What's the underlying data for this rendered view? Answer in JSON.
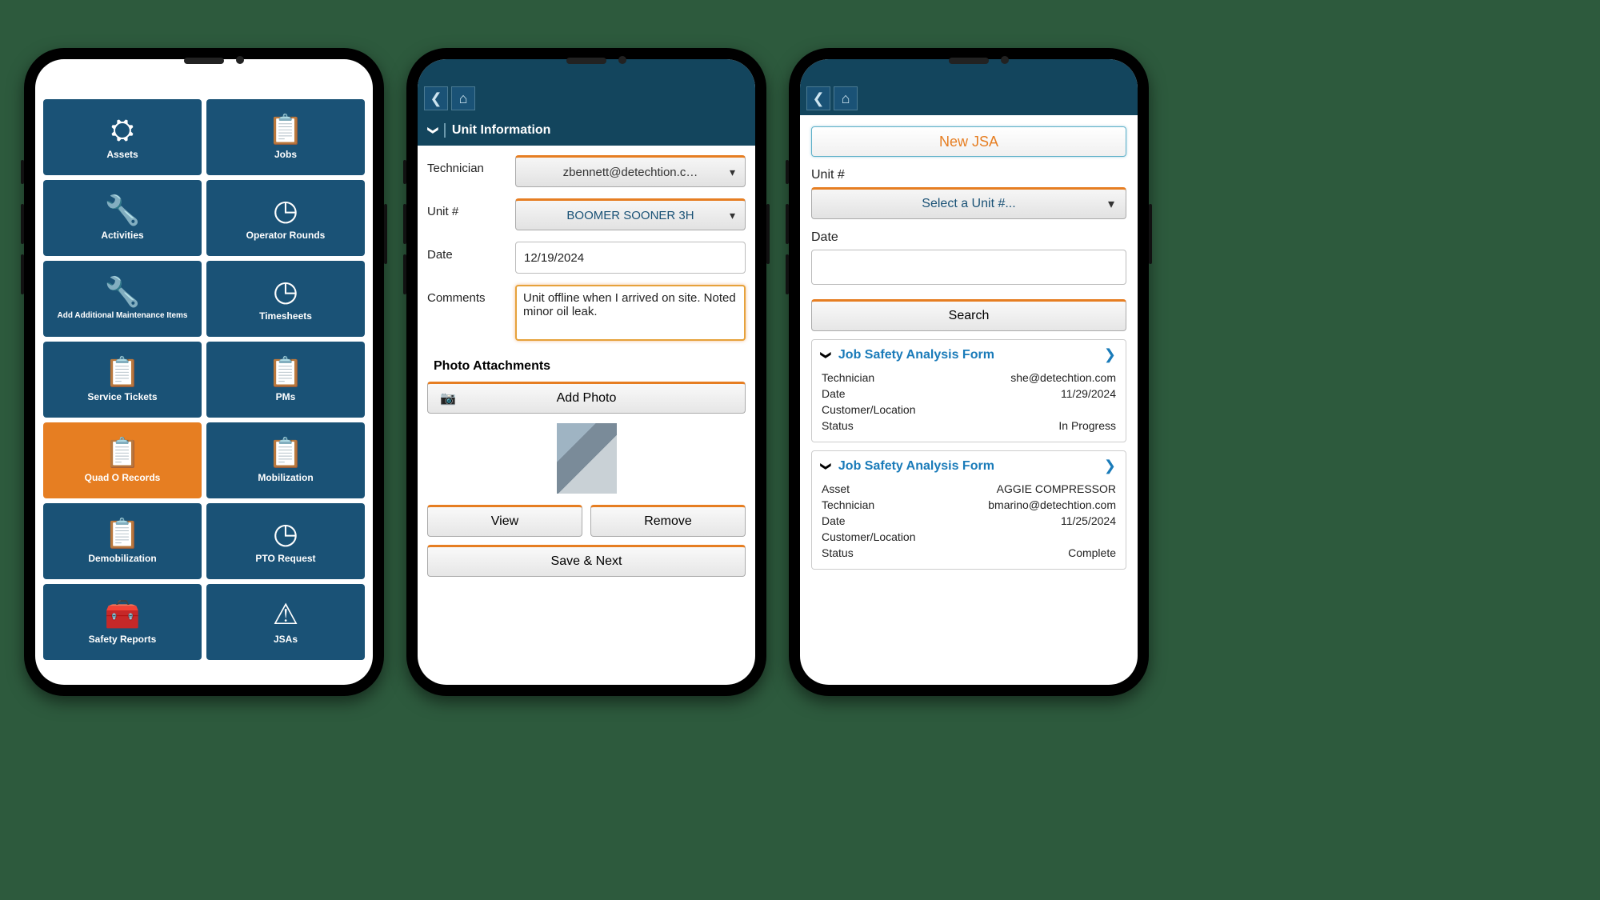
{
  "colors": {
    "primary": "#1a5276",
    "accent": "#e67e22",
    "link": "#1a7bb9"
  },
  "phone1": {
    "tiles": [
      {
        "label": "Assets",
        "icon": "⛭"
      },
      {
        "label": "Jobs",
        "icon": "📋"
      },
      {
        "label": "Activities",
        "icon": "🔧"
      },
      {
        "label": "Operator Rounds",
        "icon": "◷"
      },
      {
        "label": "Add Additional Maintenance Items",
        "icon": "🔧"
      },
      {
        "label": "Timesheets",
        "icon": "◷"
      },
      {
        "label": "Service Tickets",
        "icon": "📋"
      },
      {
        "label": "PMs",
        "icon": "📋"
      },
      {
        "label": "Quad O Records",
        "icon": "📋",
        "active": true
      },
      {
        "label": "Mobilization",
        "icon": "📋"
      },
      {
        "label": "Demobilization",
        "icon": "📋"
      },
      {
        "label": "PTO Request",
        "icon": "◷"
      },
      {
        "label": "Safety Reports",
        "icon": "🧰"
      },
      {
        "label": "JSAs",
        "icon": "⚠"
      }
    ]
  },
  "phone2": {
    "section": "Unit Information",
    "fields": {
      "technician_label": "Technician",
      "technician_value": "zbennett@detechtion.c…",
      "unit_label": "Unit #",
      "unit_value": "BOOMER SOONER 3H",
      "date_label": "Date",
      "date_value": "12/19/2024",
      "comments_label": "Comments",
      "comments_value": "Unit offline when I arrived on site. Noted minor oil leak."
    },
    "photo_header": "Photo Attachments",
    "buttons": {
      "add_photo": "Add Photo",
      "view": "View",
      "remove": "Remove",
      "save_next": "Save & Next"
    }
  },
  "phone3": {
    "new_btn": "New JSA",
    "unit_label": "Unit #",
    "unit_placeholder": "Select a Unit #...",
    "date_label": "Date",
    "search_btn": "Search",
    "cards": [
      {
        "title": "Job Safety Analysis Form",
        "rows": [
          {
            "k": "Technician",
            "v": "she@detechtion.com"
          },
          {
            "k": "Date",
            "v": "11/29/2024"
          },
          {
            "k": "Customer/Location",
            "v": ""
          },
          {
            "k": "Status",
            "v": "In Progress"
          }
        ]
      },
      {
        "title": "Job Safety Analysis Form",
        "rows": [
          {
            "k": "Asset",
            "v": "AGGIE COMPRESSOR"
          },
          {
            "k": "Technician",
            "v": "bmarino@detechtion.com"
          },
          {
            "k": "Date",
            "v": "11/25/2024"
          },
          {
            "k": "Customer/Location",
            "v": ""
          },
          {
            "k": "Status",
            "v": "Complete"
          }
        ]
      }
    ]
  }
}
